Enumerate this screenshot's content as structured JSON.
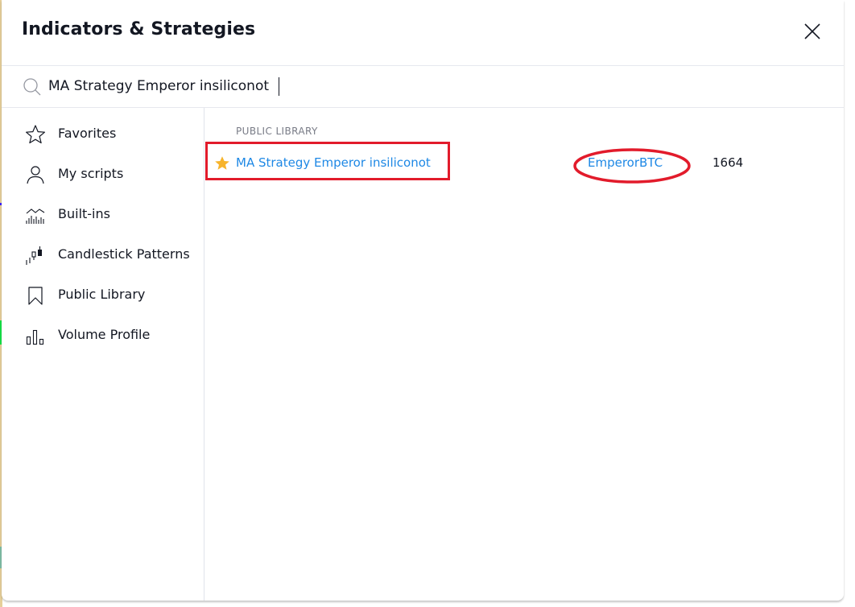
{
  "dialog": {
    "title": "Indicators & Strategies",
    "close_icon": "close-icon"
  },
  "search": {
    "value": "MA Strategy Emperor insiliconot",
    "icon": "search-icon"
  },
  "sidebar": {
    "items": [
      {
        "label": "Favorites",
        "icon": "star-outline-icon"
      },
      {
        "label": "My scripts",
        "icon": "user-icon"
      },
      {
        "label": "Built-ins",
        "icon": "built-ins-chart-icon"
      },
      {
        "label": "Candlestick Patterns",
        "icon": "candlestick-icon"
      },
      {
        "label": "Public Library",
        "icon": "bookmark-icon"
      },
      {
        "label": "Volume Profile",
        "icon": "volume-profile-icon"
      }
    ]
  },
  "results": {
    "section_label": "PUBLIC LIBRARY",
    "items": [
      {
        "name": "MA Strategy Emperor insiliconot",
        "author": "EmperorBTC",
        "likes": "1664",
        "favorited": true
      }
    ]
  },
  "colors": {
    "link": "#1e88e5",
    "star_favorite": "#f7b42c",
    "annotation_red": "#e21b2b",
    "text_primary": "#131722",
    "text_muted": "#787b86"
  }
}
